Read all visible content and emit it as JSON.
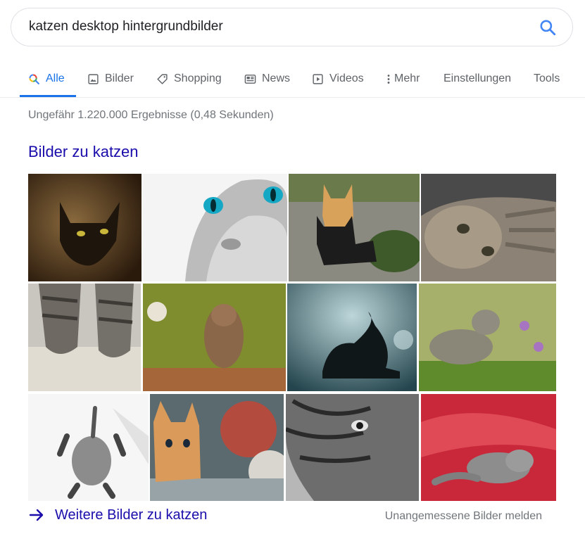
{
  "search": {
    "query": "katzen desktop hintergrundbilder"
  },
  "tabs": [
    {
      "label": "Alle",
      "icon": "search-icon",
      "active": true
    },
    {
      "label": "Bilder",
      "icon": "image-icon"
    },
    {
      "label": "Shopping",
      "icon": "tag-icon"
    },
    {
      "label": "News",
      "icon": "newspaper-icon"
    },
    {
      "label": "Videos",
      "icon": "play-icon"
    },
    {
      "label": "Mehr",
      "icon": "more-vert-icon"
    },
    {
      "label": "Einstellungen"
    },
    {
      "label": "Tools"
    }
  ],
  "results": {
    "stats": "Ungefähr 1.220.000 Ergebnisse (0,48 Sekunden)"
  },
  "images_section": {
    "title": "Bilder zu katzen",
    "more_label": "Weitere Bilder zu katzen",
    "report_label": "Unangemessene Bilder melden"
  },
  "colors": {
    "link": "#1a0dab",
    "accent": "#1a73e8",
    "muted": "#70757a",
    "search_icon": "#4285f4"
  }
}
